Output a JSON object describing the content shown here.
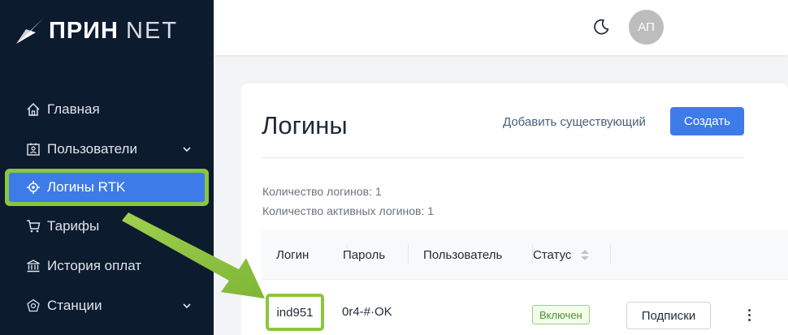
{
  "app": {
    "brand_main": "ПРИН",
    "brand_net": "NET"
  },
  "sidebar": {
    "items": [
      {
        "label": "Главная",
        "icon": "home-icon"
      },
      {
        "label": "Пользователи",
        "icon": "user-card-icon",
        "expandable": true
      },
      {
        "label": "Логины RTK",
        "icon": "target-icon",
        "active": true
      },
      {
        "label": "Тарифы",
        "icon": "cart-icon"
      },
      {
        "label": "История оплат",
        "icon": "bank-icon"
      },
      {
        "label": "Станции",
        "icon": "station-icon",
        "expandable": true
      }
    ]
  },
  "topbar": {
    "theme_icon": "moon-icon",
    "avatar_initials": "АП"
  },
  "page": {
    "title": "Логины",
    "add_existing": "Добавить существующий",
    "create": "Создать",
    "stats": {
      "total": "Количество логинов: 1",
      "active": "Количество активных логинов: 1"
    }
  },
  "table": {
    "columns": [
      "Логин",
      "Пароль",
      "Пользователь",
      "Статус"
    ],
    "rows": [
      {
        "login": "ind951",
        "password": "0r4-#·OK",
        "user": "",
        "status": "Включен",
        "action": "Подписки"
      }
    ]
  },
  "colors": {
    "sidebar_bg": "#0d1b2e",
    "accent": "#3d7be8",
    "highlight": "#8cc540",
    "status_green": "#4a9a2c"
  }
}
